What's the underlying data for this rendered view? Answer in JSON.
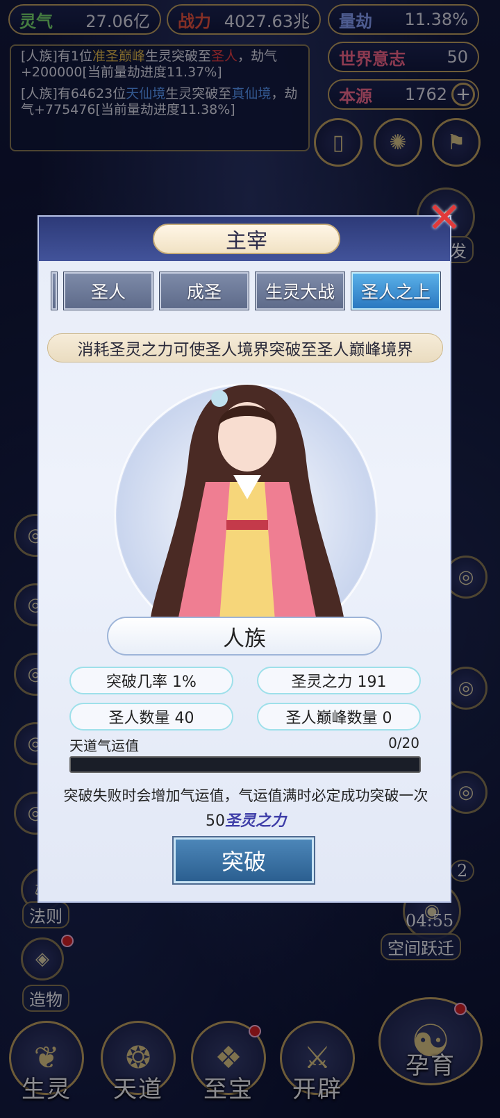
{
  "hud": {
    "lingqi": {
      "label": "灵气",
      "value": "27.06亿"
    },
    "zhanli": {
      "label": "战力",
      "value": "4027.63兆"
    },
    "liangjie": {
      "label": "量劫",
      "value": "11.38%"
    },
    "shijie": {
      "label": "世界意志",
      "value": "50"
    },
    "benyuan": {
      "label": "本源",
      "value": "1762",
      "plus": "+"
    }
  },
  "log": {
    "m1a": "[人族]有1位",
    "m1b": "准圣巅峰",
    "m1c": "生灵突破至",
    "m1d": "圣人",
    "m1e": "，劫气+200000[当前量劫进度11.37%]",
    "m2a": "[人族]有64623位",
    "m2b": "天仙境",
    "m2c": "生灵突破至",
    "m2d": "真仙境",
    "m2e": "，劫气+775476[当前量劫进度11.38%]"
  },
  "side_right": {
    "baofa": "爆发",
    "timer": "04:55",
    "kongjian": "空间跃迁",
    "badge": "2"
  },
  "side_left": {
    "faze": "法则",
    "zaowu": "造物"
  },
  "nav": [
    "生灵",
    "天道",
    "至宝",
    "开辟",
    "孕育"
  ],
  "modal": {
    "title": "主宰",
    "tabs": [
      "圣人",
      "成圣",
      "生灵大战",
      "圣人之上"
    ],
    "active_tab": "圣人之上",
    "description": "消耗圣灵之力可使圣人境界突破至圣人巅峰境界",
    "race": "人族",
    "stats": {
      "rate": "突破几率 1%",
      "power": "圣灵之力 191",
      "count": "圣人数量 40",
      "peak": "圣人巅峰数量 0"
    },
    "luck": {
      "label": "天道气运值",
      "value": "0/20",
      "fill": 0
    },
    "note": "突破失败时会增加气运值，气运值满时必定成功突破一次",
    "cost_amount": "50",
    "cost_unit": "圣灵之力",
    "button": "突破"
  },
  "colors": {
    "gold": "#c9a860",
    "active_tab": "#2a78c0",
    "red": "#f04040",
    "blue": "#5ea0ff"
  }
}
